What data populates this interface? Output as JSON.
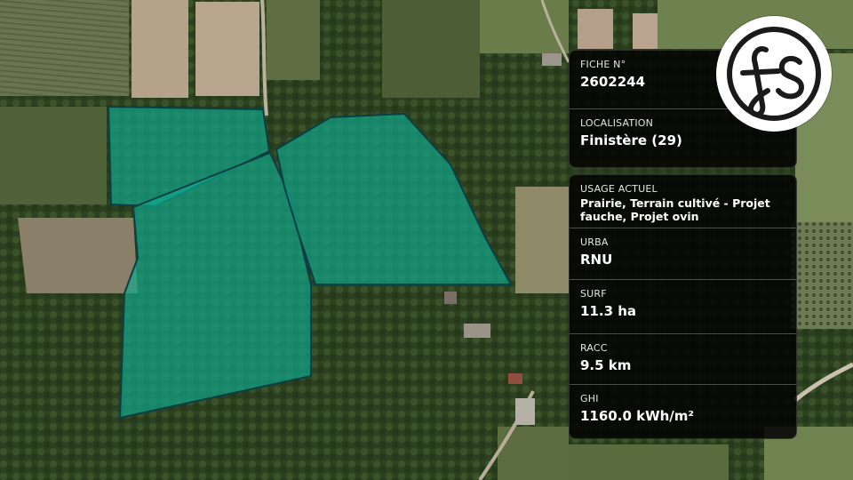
{
  "fiche": {
    "label": "FICHE N°",
    "value": "2602244"
  },
  "localisation": {
    "label": "LOCALISATION",
    "value": "Finistère (29)"
  },
  "usage": {
    "label": "USAGE ACTUEL",
    "value": "Prairie, Terrain cultivé - Projet fauche, Projet ovin"
  },
  "urba": {
    "label": "URBA",
    "value": "RNU"
  },
  "surf": {
    "label": "SURF",
    "value": "11.3 ha"
  },
  "racc": {
    "label": "RACC",
    "value": "9.5 km"
  },
  "ghi": {
    "label": "GHI",
    "value": "1160.0 kWh/m²"
  },
  "colors": {
    "parcel_fill": "#10a88c",
    "parcel_stroke": "#0a3f44",
    "panel_bg": "#000000"
  },
  "logo": {
    "icon": "fs-monogram-logo"
  }
}
